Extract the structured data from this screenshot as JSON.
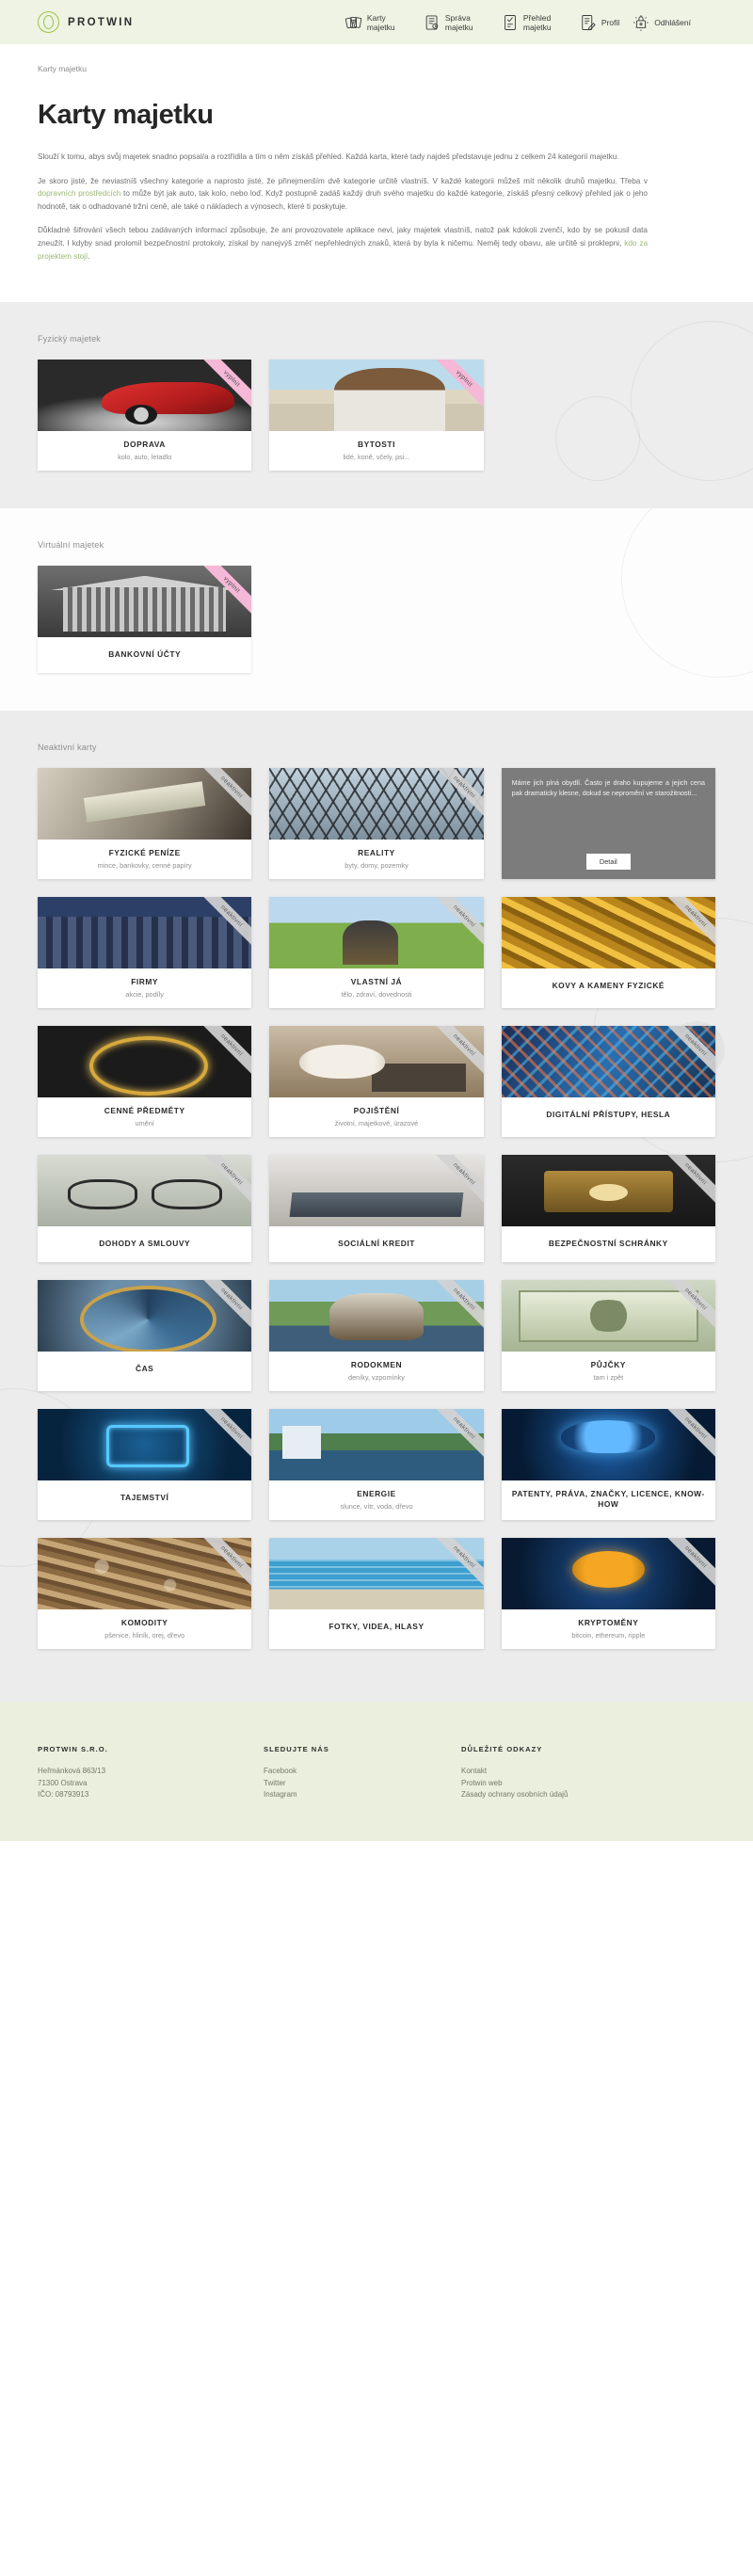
{
  "header": {
    "brand": "PROTWIN",
    "nav": [
      {
        "label": "Karty majetku",
        "icon": "cards-icon"
      },
      {
        "label": "Správa majetku",
        "icon": "manage-icon"
      },
      {
        "label": "Přehled majetku",
        "icon": "overview-icon"
      },
      {
        "label": "Profil",
        "icon": "profile-icon"
      },
      {
        "label": "Odhlášení",
        "icon": "logout-icon"
      }
    ]
  },
  "intro": {
    "breadcrumb": "Karty majetku",
    "title": "Karty majetku",
    "p1": "Slouží k tomu, abys svůj majetek snadno popsal/a a roztřídila a tím o něm získáš přehled. Každá karta, které tady najdeš představuje jednu z celkem 24 kategorií majetku.",
    "p2_a": "Je skoro jisté, že neviastníš všechny kategorie a naprosto jisté, že přinejmenším dvě kategorie určitě vlastníš. V každé kategorii můžeš mít několik druhů majetku. Třeba v ",
    "p2_link": "dopravních prostředcích",
    "p2_b": " to může být jak auto, tak kolo, nebo loď. Když postupně zadáš každý druh svého majetku do každé kategorie, získáš přesný celkový přehled jak o jeho hodnotě, tak o odhadované tržní ceně, ale také o nákladech a výnosech, které ti poskytuje.",
    "p3_a": "Důkladné šifrování všech tebou zadávaných informací způsobuje, že ani provozovatele aplikace nevi, jaky majetek vlastníš, natož pak kdokoli zvenčí, kdo by se pokusil data zneužít. I kdyby snad prolomil bezpečnostní protokoly, získal by nanejvýš změť nepřehledných znaků, která by byla k ničemu. Neměj tedy obavu, ale určitě si proklepni, ",
    "p3_link": "kdo za projektem stojí",
    "p3_b": "."
  },
  "sections": [
    {
      "name": "fyzicky-majetek",
      "title": "Fyzický majetek",
      "cards": [
        {
          "title": "DOPRAVA",
          "sub": "kolo, auto, letadlo",
          "ribbon": "vyplnit",
          "ribbon_style": "pink",
          "art": "im-car"
        },
        {
          "title": "BYTOSTI",
          "sub": "lidé, koně, včely, psi...",
          "ribbon": "vyplnit",
          "ribbon_style": "pink",
          "art": "im-girl"
        }
      ]
    },
    {
      "name": "virtualni-majetek",
      "title": "Virtuální majetek",
      "cards": [
        {
          "title": "BANKOVNÍ ÚČTY",
          "sub": "",
          "ribbon": "vyplnit",
          "ribbon_style": "pink",
          "art": "im-bank"
        }
      ]
    },
    {
      "name": "neaktivni-karty",
      "title": "Neaktivní karty",
      "cards": [
        {
          "title": "FYZICKÉ PENÍZE",
          "sub": "mince, bankovky, cenné papíry",
          "ribbon": "neaktivní",
          "ribbon_style": "grey",
          "art": "im-cash"
        },
        {
          "title": "REALITY",
          "sub": "byty, domy, pozemky",
          "ribbon": "neaktivní",
          "ribbon_style": "grey",
          "art": "im-glass"
        },
        {
          "title": "",
          "sub": "",
          "ribbon": "",
          "ribbon_style": "grey",
          "art": "im-city",
          "overlay": {
            "text": "Máme jich plná obydlí. Často je draho kupujeme a jejich cena pak dramaticky klesne, dokud se nepromění ve starožitnosti...",
            "button": "Detail"
          }
        },
        {
          "title": "FIRMY",
          "sub": "akcie, podíly",
          "ribbon": "neaktivní",
          "ribbon_style": "grey",
          "art": "im-city"
        },
        {
          "title": "VLASTNÍ JÁ",
          "sub": "tělo, zdraví, dovednosti",
          "ribbon": "neaktivní",
          "ribbon_style": "grey",
          "art": "im-field"
        },
        {
          "title": "KOVY A KAMENY FYZICKÉ",
          "sub": "",
          "ribbon": "neaktivní",
          "ribbon_style": "grey",
          "art": "im-gold"
        },
        {
          "title": "CENNÉ PŘEDMĚTY",
          "sub": "umění",
          "ribbon": "neaktivní",
          "ribbon_style": "grey",
          "art": "im-ring"
        },
        {
          "title": "POJIŠTĚNÍ",
          "sub": "životní, majetkové, úrazové",
          "ribbon": "neaktivní",
          "ribbon_style": "grey",
          "art": "im-tea"
        },
        {
          "title": "DIGITÁLNÍ PŘÍSTUPY, HESLA",
          "sub": "",
          "ribbon": "neaktivní",
          "ribbon_style": "grey",
          "art": "im-digi"
        },
        {
          "title": "DOHODY A SMLOUVY",
          "sub": "",
          "ribbon": "neaktivní",
          "ribbon_style": "grey",
          "art": "im-glasses"
        },
        {
          "title": "SOCIÁLNÍ KREDIT",
          "sub": "",
          "ribbon": "neaktivní",
          "ribbon_style": "grey",
          "art": "im-laptop"
        },
        {
          "title": "BEZPEČNOSTNÍ SCHRÁNKY",
          "sub": "",
          "ribbon": "neaktivní",
          "ribbon_style": "grey",
          "art": "im-safe"
        },
        {
          "title": "ČAS",
          "sub": "",
          "ribbon": "neaktivní",
          "ribbon_style": "grey",
          "art": "im-clock"
        },
        {
          "title": "RODOKMEN",
          "sub": "deníky, vzpomínky",
          "ribbon": "neaktivní",
          "ribbon_style": "grey",
          "art": "im-family"
        },
        {
          "title": "PŮJČKY",
          "sub": "tam i zpět",
          "ribbon": "neaktivní",
          "ribbon_style": "grey",
          "art": "im-dollar"
        },
        {
          "title": "TAJEMSTVÍ",
          "sub": "",
          "ribbon": "neaktivní",
          "ribbon_style": "grey",
          "art": "im-lock"
        },
        {
          "title": "ENERGIE",
          "sub": "slunce, vítr, voda, dřevo",
          "ribbon": "neaktivní",
          "ribbon_style": "grey",
          "art": "im-energy"
        },
        {
          "title": "PATENTY, PRÁVA, ZNAČKY, LICENCE, KNOW-HOW",
          "sub": "",
          "ribbon": "neaktivní",
          "ribbon_style": "grey",
          "art": "im-brain"
        },
        {
          "title": "KOMODITY",
          "sub": "pšenice, hliník, orej, dřevo",
          "ribbon": "neaktivní",
          "ribbon_style": "grey",
          "art": "im-wood"
        },
        {
          "title": "FOTKY, VIDEA, HLASY",
          "sub": "",
          "ribbon": "neaktivní",
          "ribbon_style": "grey",
          "art": "im-pool"
        },
        {
          "title": "KRYPTOMĚNY",
          "sub": "bitcoin, ethereum, ripple",
          "ribbon": "neaktivní",
          "ribbon_style": "grey",
          "art": "im-crypto"
        }
      ]
    }
  ],
  "footer": {
    "col1": {
      "head": "PROTWIN S.R.O.",
      "lines": [
        "Heřmánková 863/13",
        "71300 Ostrava",
        "IČO: 08793913"
      ]
    },
    "col2": {
      "head": "SLEDUJTE NÁS",
      "links": [
        "Facebook",
        "Twitter",
        "Instagram"
      ]
    },
    "col3": {
      "head": "DŮLEŽITÉ ODKAZY",
      "links": [
        "Kontakt",
        "Protwin web",
        "Zásady ochrany osobních údajů"
      ]
    }
  },
  "colors": {
    "header_bg": "#eef3e3",
    "brand_green": "#9ec24a",
    "link_green": "#9ab870",
    "ribbon_pink": "#f5b8d6",
    "footer_bg": "#eaf0dd"
  }
}
